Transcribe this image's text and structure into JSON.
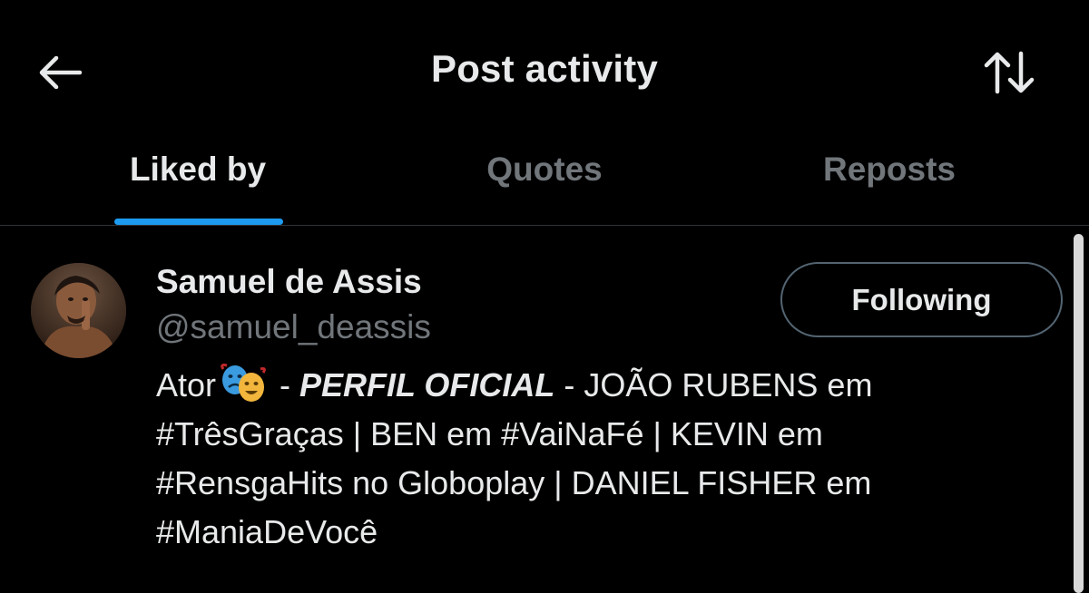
{
  "header": {
    "title": "Post activity",
    "back_icon": "arrow-left-icon",
    "sort_icon": "sort-arrows-icon"
  },
  "tabs": [
    {
      "label": "Liked by",
      "active": true
    },
    {
      "label": "Quotes",
      "active": false
    },
    {
      "label": "Reposts",
      "active": false
    }
  ],
  "colors": {
    "background": "#000000",
    "text": "#e7e9ea",
    "muted": "#71767b",
    "accent": "#1d9bf0",
    "divider": "#2f3336"
  },
  "users": [
    {
      "name": "Samuel de Assis",
      "handle": "@samuel_deassis",
      "follow_label": "Following",
      "bio": {
        "line1_prefix": "Ator",
        "emoji_icon": "performing-arts-icon",
        "line1_sep": " - ",
        "line1_bold": "PERFIL OFICIAL",
        "line1_suffix": " - JOÃO RUBENS em",
        "line2": "#TrêsGraças | BEN em #VaiNaFé | KEVIN em",
        "line3": "#RensgaHits no Globoplay | DANIEL FISHER em",
        "line4": "#ManiaDeVocê"
      }
    }
  ]
}
